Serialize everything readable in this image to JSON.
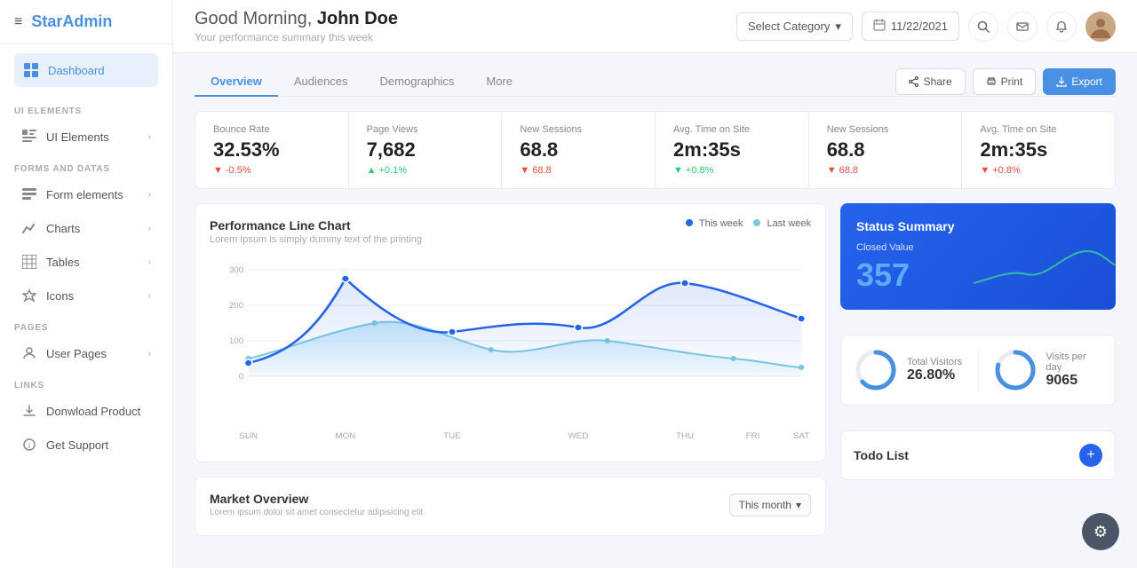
{
  "brand": {
    "icon": "≡",
    "name_part1": "Star",
    "name_part2": "Admin"
  },
  "sidebar": {
    "active_item": "Dashboard",
    "items_top": [
      {
        "label": "Dashboard",
        "icon": "⊞",
        "active": true
      }
    ],
    "section_ui": "UI ELEMENTS",
    "items_ui": [
      {
        "label": "UI Elements",
        "icon": "▣",
        "has_arrow": true
      }
    ],
    "section_forms": "FORMS AND DATAS",
    "items_forms": [
      {
        "label": "Form elements",
        "icon": "☰",
        "has_arrow": true
      },
      {
        "label": "Charts",
        "icon": "📈",
        "has_arrow": true
      },
      {
        "label": "Tables",
        "icon": "⊞",
        "has_arrow": true
      },
      {
        "label": "Icons",
        "icon": "◇",
        "has_arrow": true
      }
    ],
    "section_pages": "PAGES",
    "items_pages": [
      {
        "label": "User Pages",
        "icon": "👤",
        "has_arrow": true
      }
    ],
    "section_links": "LINKS",
    "items_links": [
      {
        "label": "Donwload Product",
        "icon": "⬇",
        "has_arrow": false
      },
      {
        "label": "Get Support",
        "icon": "ℹ",
        "has_arrow": false
      }
    ]
  },
  "topbar": {
    "greeting": "Good Morning,",
    "username": "John Doe",
    "subtitle": "Your performance summary this week",
    "category_placeholder": "Select Category",
    "date_value": "11/22/2021",
    "calendar_icon": "📅"
  },
  "tabs": {
    "items": [
      "Overview",
      "Audiences",
      "Demographics",
      "More"
    ],
    "active": "Overview"
  },
  "actions": {
    "share_label": "Share",
    "print_label": "Print",
    "export_label": "Export"
  },
  "stats": [
    {
      "label": "Bounce Rate",
      "value": "32.53%",
      "change": "-0.5%",
      "direction": "down"
    },
    {
      "label": "Page Views",
      "value": "7,682",
      "change": "+0.1%",
      "direction": "up"
    },
    {
      "label": "New Sessions",
      "value": "68.8",
      "change": "68.8",
      "direction": "down"
    },
    {
      "label": "Avg. Time on Site",
      "value": "2m:35s",
      "change": "+0.8%",
      "direction": "up"
    },
    {
      "label": "New Sessions",
      "value": "68.8",
      "change": "68.8",
      "direction": "down"
    },
    {
      "label": "Avg. Time on Site",
      "value": "2m:35s",
      "change": "+0.8%",
      "direction": "up"
    }
  ],
  "performance_chart": {
    "title": "Performance Line Chart",
    "subtitle": "Lorem Ipsum is simply dummy text of the printing",
    "legend_this_week": "This week",
    "legend_last_week": "Last week",
    "x_labels": [
      "SUN",
      "MON",
      "TUE",
      "WED",
      "THU",
      "FRI",
      "SAT"
    ],
    "y_labels": [
      "300",
      "200",
      "100",
      "0"
    ],
    "color_this_week": "#2563eb",
    "color_last_week": "#7ec8e3"
  },
  "status_summary": {
    "title": "Status Summary",
    "closed_label": "Closed Value",
    "value": "357"
  },
  "visitors": {
    "total_label": "Total Visitors",
    "total_value": "26.80%",
    "visits_label": "Visits per day",
    "visits_value": "9065"
  },
  "todo": {
    "title": "Todo List",
    "add_icon": "+"
  },
  "market_overview": {
    "title": "Market Overview",
    "subtitle": "Lorem ipsum dolor sit amet consectetur adipisicing elit",
    "month_label": "This month",
    "chevron": "▾"
  },
  "fab": {
    "icon": "⚙"
  }
}
